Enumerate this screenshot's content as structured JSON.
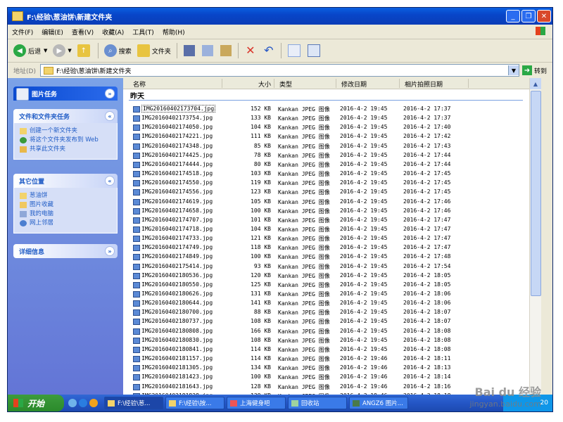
{
  "window": {
    "title": "F:\\经验\\葱油饼\\新建文件夹",
    "minimize_label": "_",
    "restore_label": "❐",
    "close_label": "✕"
  },
  "menu": [
    "文件(F)",
    "编辑(E)",
    "查看(V)",
    "收藏(A)",
    "工具(T)",
    "帮助(H)"
  ],
  "toolbar": {
    "back_label": "后退",
    "search_label": "搜索",
    "folders_label": "文件夹"
  },
  "address": {
    "label": "地址(D)",
    "value": "F:\\经验\\葱油饼\\新建文件夹",
    "go_label": "转到"
  },
  "left_pane": {
    "picture_tasks": {
      "title": "图片任务"
    },
    "file_tasks": {
      "title": "文件和文件夹任务",
      "items": [
        "创建一个新文件夹",
        "将这个文件夹发布到 Web",
        "共享此文件夹"
      ]
    },
    "other_places": {
      "title": "其它位置",
      "items": [
        "葱油饼",
        "图片收藏",
        "我的电脑",
        "网上邻居"
      ]
    },
    "details": {
      "title": "详细信息"
    }
  },
  "columns": {
    "name": "名称",
    "size": "大小",
    "type": "类型",
    "modified": "修改日期",
    "taken": "相片拍照日期"
  },
  "group_label": "昨天",
  "files": [
    {
      "name": "IMG20160402173704.jpg",
      "size": "152 KB",
      "type": "Kankan JPEG 图像",
      "modified": "2016-4-2 19:45",
      "taken": "2016-4-2 17:37"
    },
    {
      "name": "IMG20160402173754.jpg",
      "size": "133 KB",
      "type": "Kankan JPEG 图像",
      "modified": "2016-4-2 19:45",
      "taken": "2016-4-2 17:37"
    },
    {
      "name": "IMG20160402174050.jpg",
      "size": "104 KB",
      "type": "Kankan JPEG 图像",
      "modified": "2016-4-2 19:45",
      "taken": "2016-4-2 17:40"
    },
    {
      "name": "IMG20160402174221.jpg",
      "size": "111 KB",
      "type": "Kankan JPEG 图像",
      "modified": "2016-4-2 19:45",
      "taken": "2016-4-2 17:42"
    },
    {
      "name": "IMG20160402174348.jpg",
      "size": "85 KB",
      "type": "Kankan JPEG 图像",
      "modified": "2016-4-2 19:45",
      "taken": "2016-4-2 17:43"
    },
    {
      "name": "IMG20160402174425.jpg",
      "size": "78 KB",
      "type": "Kankan JPEG 图像",
      "modified": "2016-4-2 19:45",
      "taken": "2016-4-2 17:44"
    },
    {
      "name": "IMG20160402174444.jpg",
      "size": "80 KB",
      "type": "Kankan JPEG 图像",
      "modified": "2016-4-2 19:45",
      "taken": "2016-4-2 17:44"
    },
    {
      "name": "IMG20160402174518.jpg",
      "size": "103 KB",
      "type": "Kankan JPEG 图像",
      "modified": "2016-4-2 19:45",
      "taken": "2016-4-2 17:45"
    },
    {
      "name": "IMG20160402174550.jpg",
      "size": "119 KB",
      "type": "Kankan JPEG 图像",
      "modified": "2016-4-2 19:45",
      "taken": "2016-4-2 17:45"
    },
    {
      "name": "IMG20160402174556.jpg",
      "size": "123 KB",
      "type": "Kankan JPEG 图像",
      "modified": "2016-4-2 19:45",
      "taken": "2016-4-2 17:45"
    },
    {
      "name": "IMG20160402174619.jpg",
      "size": "105 KB",
      "type": "Kankan JPEG 图像",
      "modified": "2016-4-2 19:45",
      "taken": "2016-4-2 17:46"
    },
    {
      "name": "IMG20160402174658.jpg",
      "size": "100 KB",
      "type": "Kankan JPEG 图像",
      "modified": "2016-4-2 19:45",
      "taken": "2016-4-2 17:46"
    },
    {
      "name": "IMG20160402174707.jpg",
      "size": "101 KB",
      "type": "Kankan JPEG 图像",
      "modified": "2016-4-2 19:45",
      "taken": "2016-4-2 17:47"
    },
    {
      "name": "IMG20160402174718.jpg",
      "size": "104 KB",
      "type": "Kankan JPEG 图像",
      "modified": "2016-4-2 19:45",
      "taken": "2016-4-2 17:47"
    },
    {
      "name": "IMG20160402174733.jpg",
      "size": "121 KB",
      "type": "Kankan JPEG 图像",
      "modified": "2016-4-2 19:45",
      "taken": "2016-4-2 17:47"
    },
    {
      "name": "IMG20160402174749.jpg",
      "size": "118 KB",
      "type": "Kankan JPEG 图像",
      "modified": "2016-4-2 19:45",
      "taken": "2016-4-2 17:47"
    },
    {
      "name": "IMG20160402174849.jpg",
      "size": "100 KB",
      "type": "Kankan JPEG 图像",
      "modified": "2016-4-2 19:45",
      "taken": "2016-4-2 17:48"
    },
    {
      "name": "IMG20160402175414.jpg",
      "size": "93 KB",
      "type": "Kankan JPEG 图像",
      "modified": "2016-4-2 19:45",
      "taken": "2016-4-2 17:54"
    },
    {
      "name": "IMG20160402180536.jpg",
      "size": "120 KB",
      "type": "Kankan JPEG 图像",
      "modified": "2016-4-2 19:45",
      "taken": "2016-4-2 18:05"
    },
    {
      "name": "IMG20160402180550.jpg",
      "size": "125 KB",
      "type": "Kankan JPEG 图像",
      "modified": "2016-4-2 19:45",
      "taken": "2016-4-2 18:05"
    },
    {
      "name": "IMG20160402180626.jpg",
      "size": "131 KB",
      "type": "Kankan JPEG 图像",
      "modified": "2016-4-2 19:45",
      "taken": "2016-4-2 18:06"
    },
    {
      "name": "IMG20160402180644.jpg",
      "size": "141 KB",
      "type": "Kankan JPEG 图像",
      "modified": "2016-4-2 19:45",
      "taken": "2016-4-2 18:06"
    },
    {
      "name": "IMG20160402180700.jpg",
      "size": "88 KB",
      "type": "Kankan JPEG 图像",
      "modified": "2016-4-2 19:45",
      "taken": "2016-4-2 18:07"
    },
    {
      "name": "IMG20160402180737.jpg",
      "size": "108 KB",
      "type": "Kankan JPEG 图像",
      "modified": "2016-4-2 19:45",
      "taken": "2016-4-2 18:07"
    },
    {
      "name": "IMG20160402180808.jpg",
      "size": "166 KB",
      "type": "Kankan JPEG 图像",
      "modified": "2016-4-2 19:45",
      "taken": "2016-4-2 18:08"
    },
    {
      "name": "IMG20160402180830.jpg",
      "size": "108 KB",
      "type": "Kankan JPEG 图像",
      "modified": "2016-4-2 19:45",
      "taken": "2016-4-2 18:08"
    },
    {
      "name": "IMG20160402180841.jpg",
      "size": "114 KB",
      "type": "Kankan JPEG 图像",
      "modified": "2016-4-2 19:45",
      "taken": "2016-4-2 18:08"
    },
    {
      "name": "IMG20160402181157.jpg",
      "size": "114 KB",
      "type": "Kankan JPEG 图像",
      "modified": "2016-4-2 19:46",
      "taken": "2016-4-2 18:11"
    },
    {
      "name": "IMG20160402181305.jpg",
      "size": "134 KB",
      "type": "Kankan JPEG 图像",
      "modified": "2016-4-2 19:46",
      "taken": "2016-4-2 18:13"
    },
    {
      "name": "IMG20160402181423.jpg",
      "size": "100 KB",
      "type": "Kankan JPEG 图像",
      "modified": "2016-4-2 19:46",
      "taken": "2016-4-2 18:14"
    },
    {
      "name": "IMG20160402181643.jpg",
      "size": "128 KB",
      "type": "Kankan JPEG 图像",
      "modified": "2016-4-2 19:46",
      "taken": "2016-4-2 18:16"
    },
    {
      "name": "IMG20160402181828.jpg",
      "size": "129 KB",
      "type": "Kankan JPEG 图像",
      "modified": "2016-4-2 19:46",
      "taken": "2016-4-2 18:18"
    }
  ],
  "taskbar": {
    "start_label": "开始",
    "tasks": [
      "F:\\经验\\葱...",
      "F:\\经验\\按...",
      "上海健身吧",
      "回收站",
      "ANGZ6 图片..."
    ],
    "clock": "20"
  },
  "watermark": {
    "line1": "Bai du 经验",
    "line2": "jingyan.baidu.com"
  }
}
